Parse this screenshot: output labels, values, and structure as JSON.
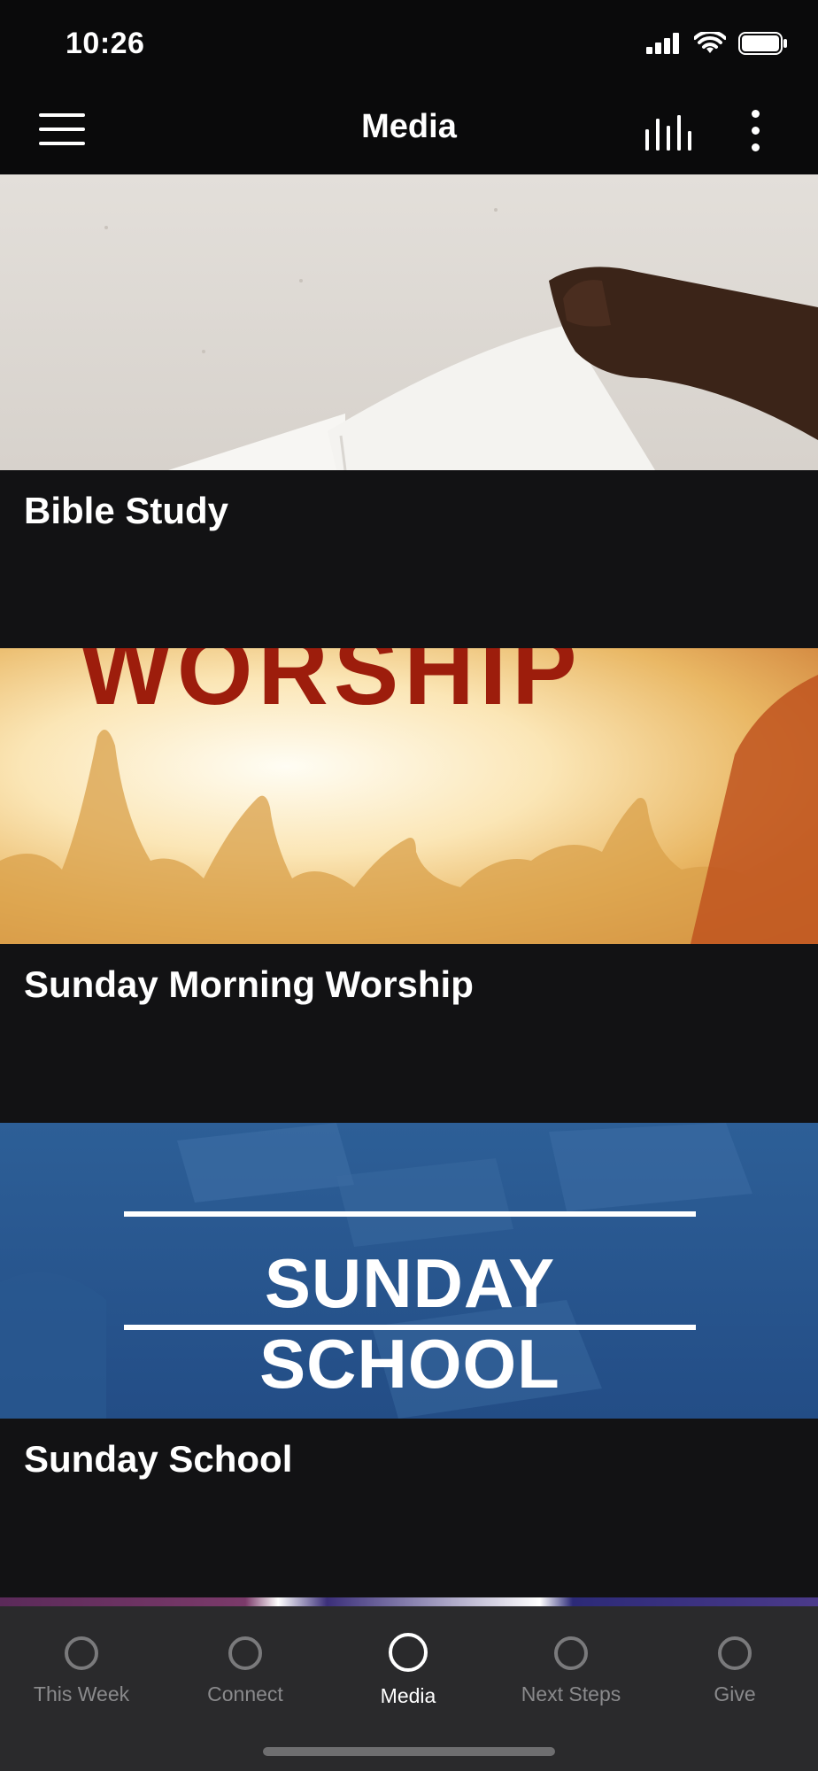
{
  "status_bar": {
    "time": "10:26"
  },
  "app_bar": {
    "title": "Media"
  },
  "cards": [
    {
      "title": "Bible Study"
    },
    {
      "title": "Sunday Morning Worship",
      "image_text": "WORSHIP"
    },
    {
      "title": "Sunday School",
      "image_text": "SUNDAY SCHOOL"
    }
  ],
  "tabs": [
    {
      "label": "This Week",
      "active": false
    },
    {
      "label": "Connect",
      "active": false
    },
    {
      "label": "Media",
      "active": true
    },
    {
      "label": "Next Steps",
      "active": false
    },
    {
      "label": "Give",
      "active": false
    }
  ],
  "colors": {
    "background": "#121214",
    "bar": "#0a0a0b",
    "tab_bar": "#2a2a2c",
    "inactive_tab": "#8a8a8c",
    "active_tab": "#ffffff"
  }
}
